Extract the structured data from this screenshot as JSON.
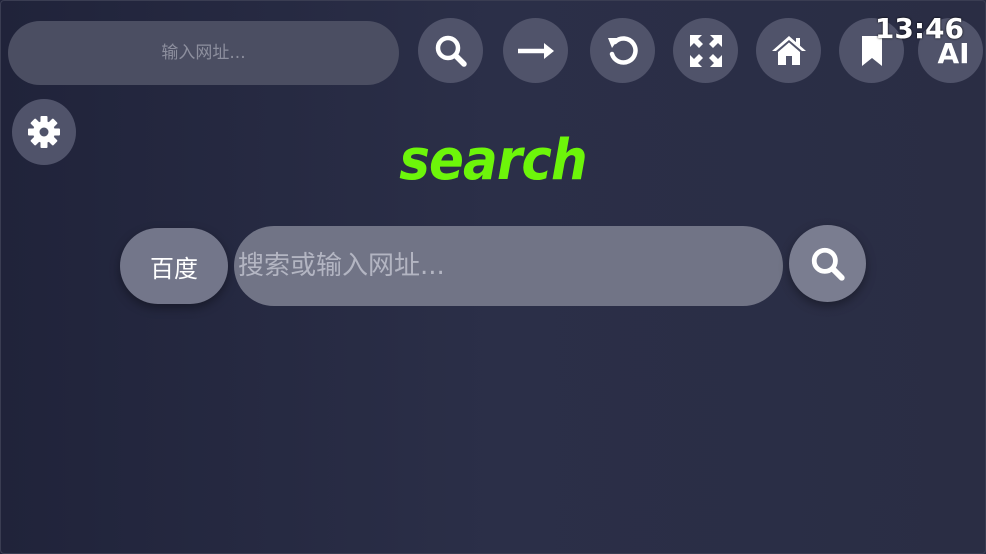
{
  "toolbar": {
    "url_placeholder": "输入网址...",
    "buttons": [
      {
        "name": "search-button",
        "icon": "search-icon"
      },
      {
        "name": "go-button",
        "icon": "arrow-right-icon"
      },
      {
        "name": "reload-button",
        "icon": "reload-icon"
      },
      {
        "name": "fullscreen-button",
        "icon": "expand-icon"
      },
      {
        "name": "home-button",
        "icon": "home-icon"
      },
      {
        "name": "bookmark-button",
        "icon": "bookmark-icon"
      },
      {
        "name": "ai-button",
        "label": "AI"
      }
    ],
    "settings_icon": "gear-icon"
  },
  "status": {
    "time": "13:46"
  },
  "main": {
    "logo_text": "search",
    "engine_label": "百度",
    "search_placeholder": "搜索或输入网址...",
    "submit_icon": "search-icon"
  },
  "colors": {
    "logo": "#6df50a",
    "button_bg": "#50536a",
    "input_bg": "#717486"
  }
}
